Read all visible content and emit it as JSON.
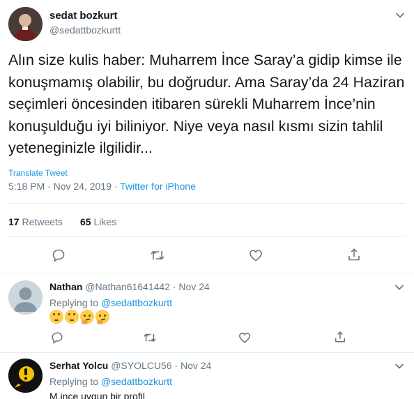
{
  "tweet": {
    "author_name": "sedat bozkurt",
    "author_handle": "@sedattbozkurtt",
    "text": "Alın size kulis haber: Muharrem İnce Saray’a gidip kimse ile konuşmamış olabilir, bu doğrudur. Ama Saray’da 24 Haziran seçimleri öncesinden itibaren sürekli Muharrem İnce’nin konuşulduğu iyi biliniyor. Niye veya nasıl kısmı sizin tahlil yeteneginizle ilgilidir...",
    "translate_label": "Translate Tweet",
    "timestamp": "5:18 PM · Nov 24, 2019 · ",
    "source": "Twitter for iPhone",
    "retweets_count": "17",
    "retweets_label": " Retweets",
    "likes_count": "65",
    "likes_label": " Likes"
  },
  "replies": [
    {
      "name": "Nathan",
      "handle": "@Nathan61641442 · Nov 24",
      "replying_label": "Replying to ",
      "replying_to": "@sedattbozkurtt",
      "emojis": [
        "face-with-rolling-eyes",
        "face-with-rolling-eyes",
        "thinking-face",
        "thinking-face"
      ]
    },
    {
      "name": "Serhat Yolcu",
      "handle": "@SYOLCU56 · Nov 24",
      "replying_label": "Replying to ",
      "replying_to": "@sedattbozkurtt",
      "text": "M.ince uygun bir profil"
    }
  ],
  "colors": {
    "link": "#1b95e0",
    "muted": "#657786",
    "text": "#14171a",
    "divider": "#e6ecf0"
  },
  "icons": [
    "chevron-down-icon",
    "reply-icon",
    "retweet-icon",
    "like-icon",
    "share-icon",
    "avatar-placeholder-icon"
  ]
}
